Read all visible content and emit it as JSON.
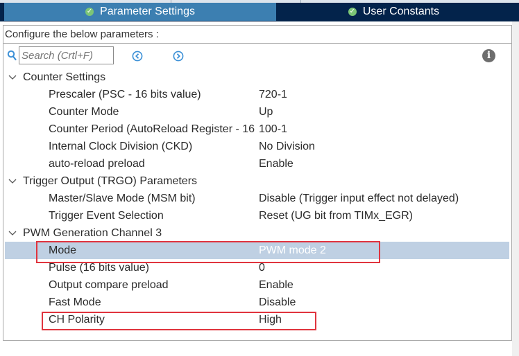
{
  "tabs": [
    {
      "label": "Parameter Settings",
      "active": true
    },
    {
      "label": "User Constants",
      "active": false
    }
  ],
  "configure_label": "Configure the below parameters :",
  "search": {
    "placeholder": "Search (Crtl+F)"
  },
  "icons": {
    "search": "search-icon",
    "prev": "arrow-left-circle-icon",
    "next": "arrow-right-circle-icon",
    "info": "info-icon",
    "tab_check": "check-circle-icon",
    "expand": "chevron-down-icon"
  },
  "groups": [
    {
      "label": "Counter Settings",
      "params": [
        {
          "label": "Prescaler (PSC - 16 bits value)",
          "value": "720-1"
        },
        {
          "label": "Counter Mode",
          "value": "Up"
        },
        {
          "label": "Counter Period (AutoReload Register - 16 ...",
          "value": "100-1"
        },
        {
          "label": "Internal Clock Division (CKD)",
          "value": "No Division"
        },
        {
          "label": "auto-reload preload",
          "value": "Enable"
        }
      ]
    },
    {
      "label": "Trigger Output (TRGO) Parameters",
      "params": [
        {
          "label": "Master/Slave Mode (MSM bit)",
          "value": "Disable (Trigger input effect not delayed)"
        },
        {
          "label": "Trigger Event Selection",
          "value": "Reset (UG bit from TIMx_EGR)"
        }
      ]
    },
    {
      "label": "PWM Generation Channel 3",
      "params": [
        {
          "label": "Mode",
          "value": "PWM mode 2",
          "selected": true
        },
        {
          "label": "Pulse (16 bits value)",
          "value": "0"
        },
        {
          "label": "Output compare preload",
          "value": "Enable"
        },
        {
          "label": "Fast Mode",
          "value": "Disable"
        },
        {
          "label": "CH Polarity",
          "value": "High"
        }
      ]
    }
  ],
  "colors": {
    "tab_bar": "#03234b",
    "tab_active": "#3c7fb1",
    "selected_row": "#bfd0e3",
    "highlight_box": "#e0343e",
    "check": "#7cc576"
  }
}
